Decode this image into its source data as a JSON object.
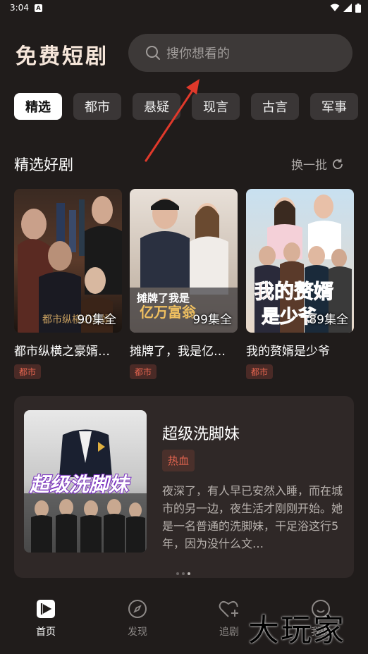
{
  "status_bar": {
    "time": "3:04",
    "notification": "A"
  },
  "header": {
    "app_title": "免费短剧",
    "search_placeholder": "搜你想看的"
  },
  "tabs": [
    {
      "label": "精选",
      "active": true
    },
    {
      "label": "都市",
      "active": false
    },
    {
      "label": "悬疑",
      "active": false
    },
    {
      "label": "现言",
      "active": false
    },
    {
      "label": "古言",
      "active": false
    },
    {
      "label": "军事",
      "active": false
    }
  ],
  "section": {
    "title": "精选好剧",
    "refresh_label": "换一批"
  },
  "cards": [
    {
      "title": "都市纵横之豪婿…",
      "episodes": "90集全",
      "tag": "都市",
      "poster_text": "都市纵横之豪婿"
    },
    {
      "title": "摊牌了，我是亿…",
      "episodes": "99集全",
      "tag": "都市",
      "poster_text_1": "摊牌了我是",
      "poster_text_2": "亿万富翁"
    },
    {
      "title": "我的赘婿是少爷",
      "episodes": "89集全",
      "tag": "都市",
      "poster_text_1": "我的赘婿",
      "poster_text_2": "是少爷"
    }
  ],
  "feature": {
    "title": "超级洗脚妹",
    "tag": "热血",
    "poster_text": "超级洗脚妹",
    "description": "夜深了，有人早已安然入睡，而在城市的另一边，夜生活才刚刚开始。她是一名普通的洗脚妹，干足浴这行5年，因为没什么文…"
  },
  "bottom_nav": [
    {
      "label": "首页",
      "active": true
    },
    {
      "label": "发现",
      "active": false
    },
    {
      "label": "追剧",
      "active": false
    },
    {
      "label": "我的",
      "active": false
    }
  ],
  "watermark": "大玩家",
  "colors": {
    "background": "#201c1b",
    "accent": "#e2644f",
    "title": "#f6e6da",
    "annotation_arrow": "#e0392b"
  }
}
